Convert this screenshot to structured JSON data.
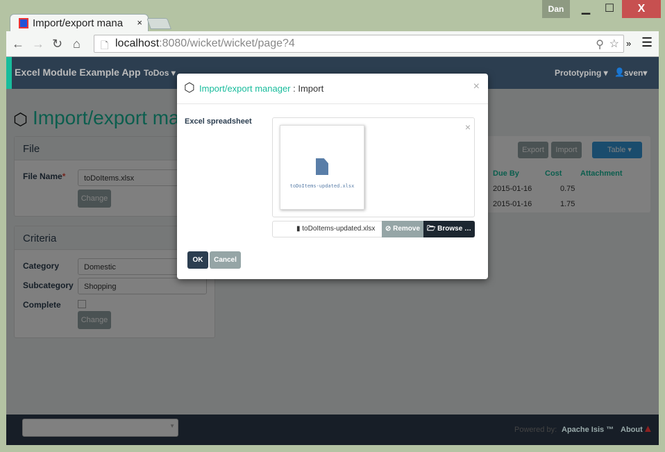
{
  "window": {
    "user": "Dan",
    "minimize": "▁",
    "maximize": "☐",
    "close": "X"
  },
  "browser": {
    "tab_title": "Import/export mana",
    "tab_close": "×",
    "url_host": "localhost",
    "url_rest": ":8080/wicket/wicket/page?4",
    "more": "»"
  },
  "navbar": {
    "brand": "Excel Module Example App",
    "menu_todos": "ToDos ▾",
    "menu_prototyping": "Prototyping ▾",
    "menu_user": "sven▾"
  },
  "page": {
    "title": "Import/export man",
    "file_panel": {
      "heading": "File",
      "file_name_label": "File Name",
      "required": "*",
      "file_name_value": "toDoItems.xlsx",
      "change": "Change"
    },
    "criteria_panel": {
      "heading": "Criteria",
      "category_label": "Category",
      "category_value": "Domestic",
      "subcategory_label": "Subcategory",
      "subcategory_value": "Shopping",
      "complete_label": "Complete",
      "change": "Change"
    },
    "table": {
      "export": "Export",
      "import": "Import",
      "view": "Table",
      "columns": [
        "Due By",
        "Cost",
        "Attachment"
      ],
      "rows": [
        [
          "2015-01-16",
          "0.75",
          ""
        ],
        [
          "2015-01-16",
          "1.75",
          ""
        ]
      ]
    }
  },
  "modal": {
    "title_link": "Import/export manager",
    "title_sep": " : ",
    "title_action": "Import",
    "close": "×",
    "field_label": "Excel spreadsheet",
    "preview_filename": "toDoItems-updated.xlsx",
    "preview_close": "×",
    "selected_file": "toDoItems-updated.xlsx",
    "remove": "Remove",
    "browse": "Browse …",
    "ok": "OK",
    "cancel": "Cancel"
  },
  "footer": {
    "powered_by": "Powered by:",
    "isis": "Apache Isis ™",
    "about": "About"
  },
  "colors": {
    "accent": "#18bc9c",
    "navbar": "#2c3e50",
    "primary": "#2c3e50",
    "grey": "#95a5a6",
    "info": "#3498db",
    "danger": "#e74c3c"
  }
}
